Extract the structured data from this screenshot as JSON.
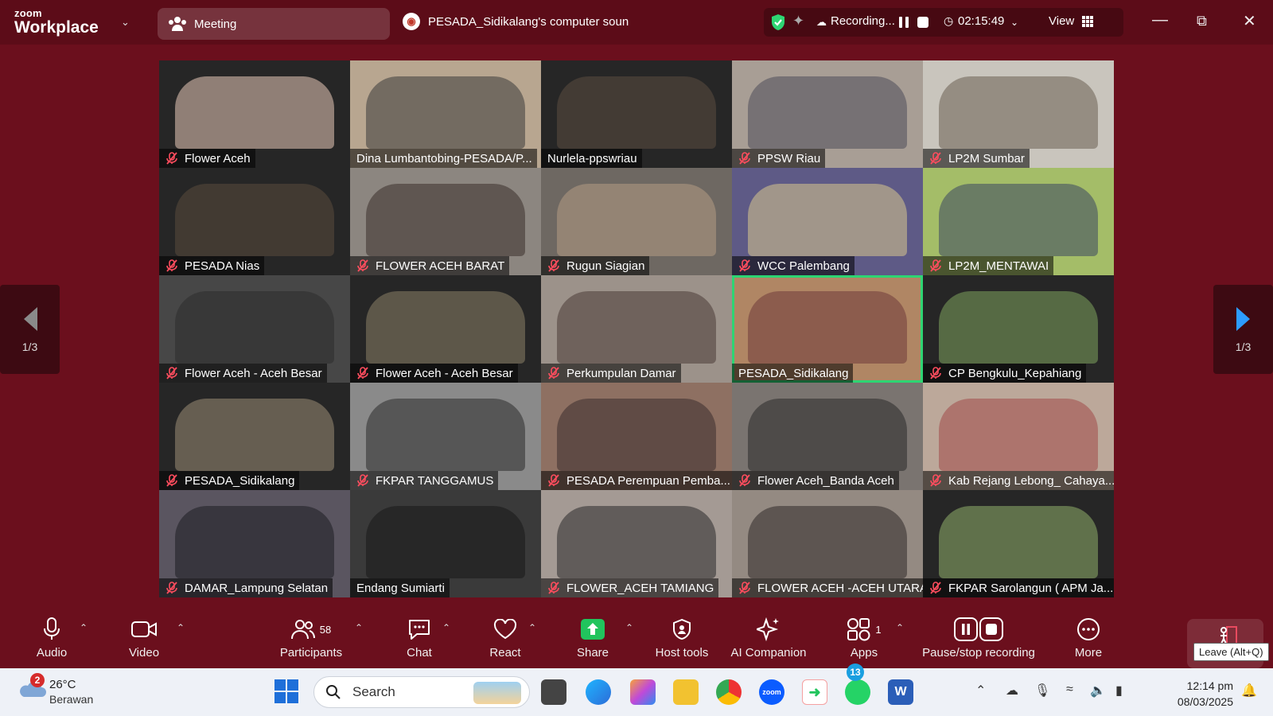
{
  "app": {
    "brand_top": "zoom",
    "brand_bottom": "Workplace"
  },
  "meeting": {
    "label": "Meeting"
  },
  "share": {
    "title": "PESADA_Sidikalang's computer soun"
  },
  "status": {
    "recording": "Recording...",
    "timer": "02:15:49",
    "view": "View"
  },
  "pager": {
    "prev": "1/3",
    "next": "1/3"
  },
  "active_speaker": "PESADA_Sidikalang",
  "tiles": [
    {
      "name": "Flower Aceh",
      "bg": "#262626",
      "photo": "#e8c9b8",
      "muted": true
    },
    {
      "name": "Dina Lumbantobing-PESADA/P...",
      "bg": "#b8a690",
      "photo": "#3a3a3a",
      "muted": false
    },
    {
      "name": "Nurlela-ppswriau",
      "bg": "#262626",
      "photo": "#5b4d3f",
      "muted": false
    },
    {
      "name": "PPSW Riau",
      "bg": "#a89e95",
      "photo": "#4c4c5a",
      "muted": true
    },
    {
      "name": "LP2M Sumbar",
      "bg": "#c9c5bd",
      "photo": "#6a5e52",
      "muted": true
    },
    {
      "name": "PESADA Nias",
      "bg": "#262626",
      "photo": "#5a4a3c",
      "muted": true
    },
    {
      "name": "FLOWER ACEH BARAT",
      "bg": "#8c8680",
      "photo": "#3a2f2a",
      "muted": true
    },
    {
      "name": "Rugun Siagian",
      "bg": "#6e6862",
      "photo": "#b49a84",
      "muted": true
    },
    {
      "name": "WCC Palembang",
      "bg": "#5e5a86",
      "photo": "#d9c98e",
      "muted": true
    },
    {
      "name": "LP2M_MENTAWAI",
      "bg": "#a4bd68",
      "photo": "#3a4760",
      "muted": true
    },
    {
      "name": "Flower Aceh - Aceh Besar",
      "bg": "#474747",
      "photo": "#2b2b2b",
      "muted": true
    },
    {
      "name": "Flower Aceh - Aceh Besar",
      "bg": "#262626",
      "photo": "#8b7f66",
      "muted": true
    },
    {
      "name": "Perkumpulan Damar",
      "bg": "#9c928a",
      "photo": "#4a3b36",
      "muted": true
    },
    {
      "name": "PESADA_Sidikalang",
      "bg": "#b08664",
      "photo": "#6f3b3b",
      "muted": false
    },
    {
      "name": "CP Bengkulu_Kepahiang",
      "bg": "#262626",
      "photo": "#7ea35c",
      "muted": true
    },
    {
      "name": "PESADA_Sidikalang",
      "bg": "#262626",
      "photo": "#9a8c74",
      "muted": true
    },
    {
      "name": "FKPAR TANGGAMUS",
      "bg": "#8a8a8a",
      "photo": "#2c2c2c",
      "muted": true
    },
    {
      "name": "PESADA Perempuan Pemba...",
      "bg": "#8e7062",
      "photo": "#3a2d2d",
      "muted": true
    },
    {
      "name": "Flower Aceh_Banda Aceh",
      "bg": "#7a7470",
      "photo": "#2a2a2a",
      "muted": true
    },
    {
      "name": "Kab Rejang Lebong_ Cahaya...",
      "bg": "#bca89a",
      "photo": "#a04848",
      "muted": true
    },
    {
      "name": "DAMAR_Lampung Selatan",
      "bg": "#5a5560",
      "photo": "#1d1d22",
      "muted": true
    },
    {
      "name": "Endang Sumiarti",
      "bg": "#3a3a3a",
      "photo": "#171717",
      "muted": false
    },
    {
      "name": "FLOWER_ACEH TAMIANG",
      "bg": "#a49a94",
      "photo": "#2a2a2a",
      "muted": true
    },
    {
      "name": "FLOWER ACEH -ACEH UTARA",
      "bg": "#948a82",
      "photo": "#2f2a2a",
      "muted": true
    },
    {
      "name": "FKPAR Sarolangun ( APM Ja...",
      "bg": "#262626",
      "photo": "#8fae6a",
      "muted": true
    }
  ],
  "toolbar": {
    "audio": "Audio",
    "video": "Video",
    "participants": "Participants",
    "participants_count": "58",
    "chat": "Chat",
    "react": "React",
    "share": "Share",
    "host_tools": "Host tools",
    "ai_companion": "AI Companion",
    "apps": "Apps",
    "apps_count": "1",
    "pause_stop": "Pause/stop recording",
    "more": "More",
    "leave_tooltip": "Leave (Alt+Q)"
  },
  "taskbar": {
    "weather_temp": "26°C",
    "weather_desc": "Berawan",
    "weather_badge": "2",
    "search_placeholder": "Search",
    "whatsapp_badge": "13",
    "time": "12:14 pm",
    "date": "08/03/2025"
  },
  "colors": {
    "accent_green": "#2ed573",
    "zoom_blue": "#0b5cff",
    "share_green": "#21c45d"
  }
}
